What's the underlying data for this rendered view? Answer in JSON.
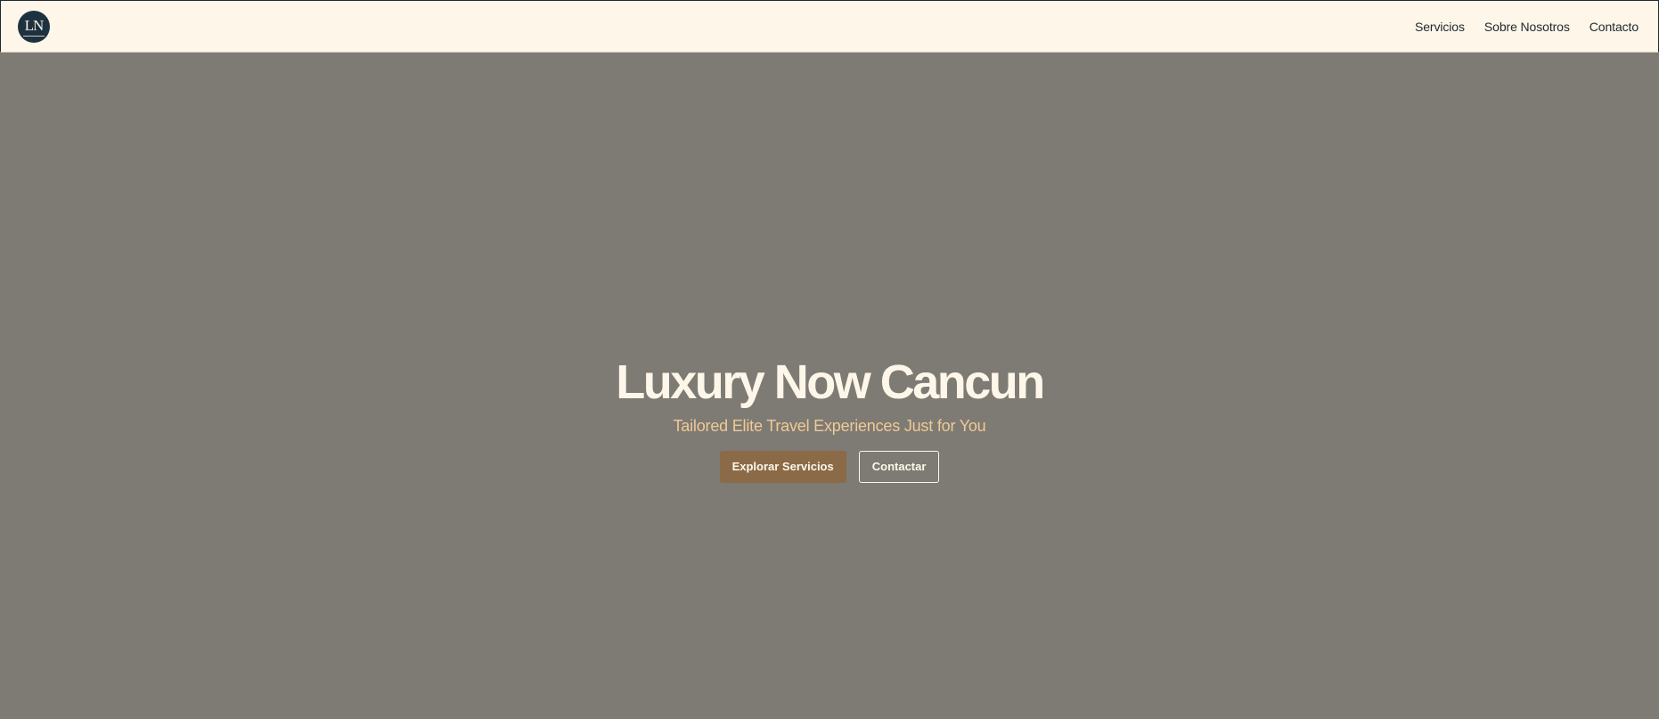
{
  "navbar": {
    "logo": {
      "icon": "ln-monogram-logo",
      "text": "LN",
      "background": "#1e3140"
    },
    "links": [
      {
        "label": "Servicios"
      },
      {
        "label": "Sobre Nosotros"
      },
      {
        "label": "Contacto"
      }
    ],
    "background": "#fdf6e9"
  },
  "hero": {
    "title": "Luxury Now Cancun",
    "subtitle": "Tailored Elite Travel Experiences Just for You",
    "background": "#7e7b74",
    "primary_button": {
      "label": "Explorar Servicios",
      "color": "#8a6a47"
    },
    "secondary_button": {
      "label": "Contactar"
    },
    "title_color": "#fdf6e9",
    "subtitle_color": "#f0c994"
  }
}
